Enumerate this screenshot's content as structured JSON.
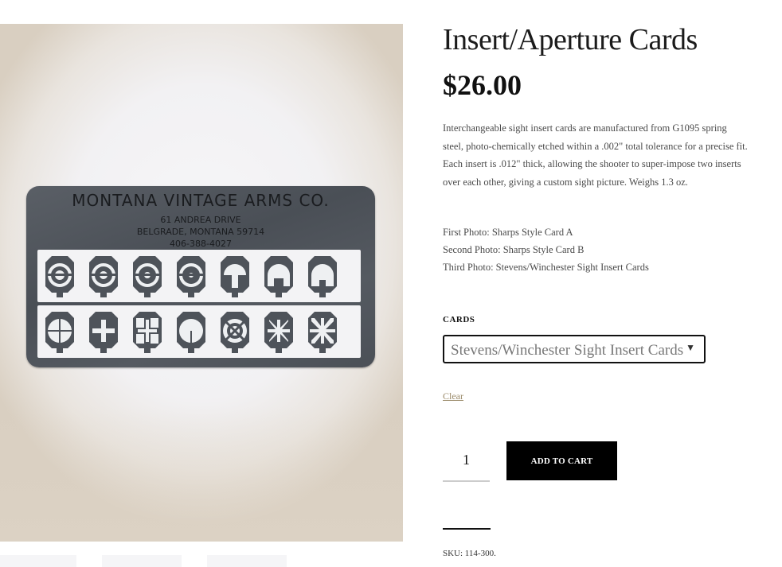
{
  "card_image": {
    "line1": "MONTANA VINTAGE ARMS CO.",
    "line2": "61 ANDREA DRIVE",
    "line3": "BELGRADE, MONTANA 59714",
    "line4": "406-388-4027"
  },
  "product": {
    "title": "Insert/Aperture Cards",
    "price": "$26.00",
    "description": "Interchangeable sight insert cards are manufactured from G1095 spring steel, photo-chemically etched within a .002\" total tolerance for a precise fit. Each insert is .012\" thick, allowing the shooter to super-impose two inserts over each other, giving a custom sight picture. Weighs 1.3 oz.",
    "photos": [
      "First Photo: Sharps Style Card A",
      "Second Photo: Sharps Style Card B",
      "Third Photo: Stevens/Winchester Sight Insert Cards"
    ],
    "cards_label": "CARDS",
    "cards_selected": "Stevens/Winchester Sight Insert Cards",
    "clear_label": "Clear",
    "quantity": "1",
    "add_to_cart_label": "ADD TO CART",
    "sku": "SKU: 114-300."
  },
  "colors": {
    "button_bg": "#000000",
    "clear_link": "#9b8b6a"
  },
  "icons": {
    "select_arrow": "chevron-down-icon"
  }
}
